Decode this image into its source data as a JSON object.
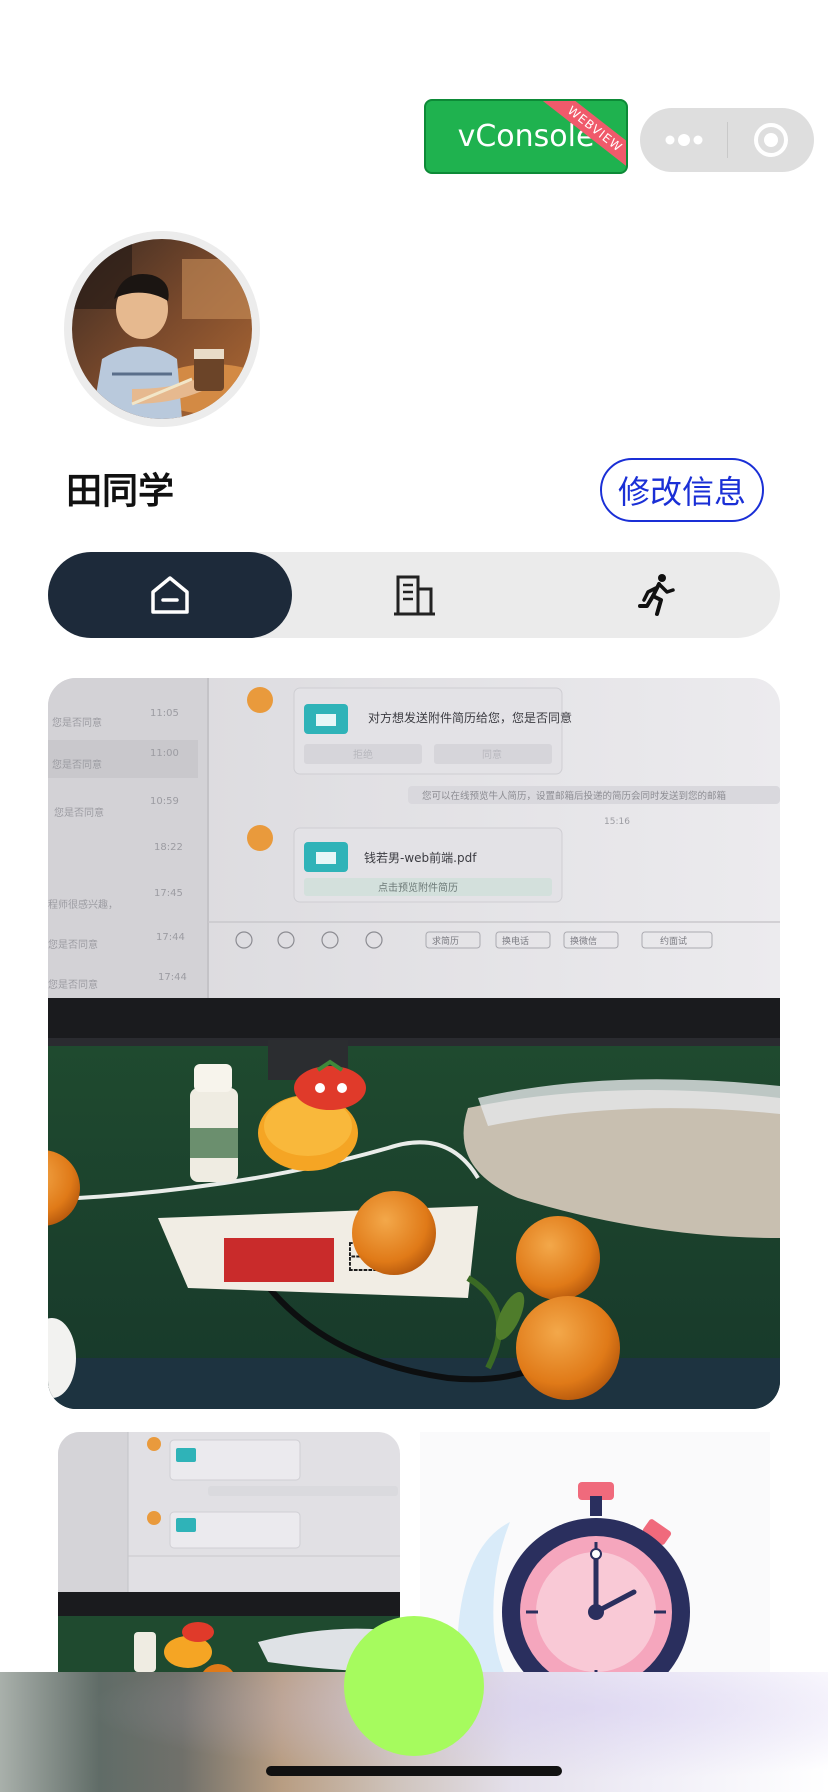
{
  "vconsole": {
    "label": "vConsole",
    "ribbon": "WEBVIEW"
  },
  "capsule": {
    "more_icon": "more-dots-icon",
    "close_icon": "target-circle-icon"
  },
  "profile": {
    "name": "田同学",
    "edit_label": "修改信息",
    "avatar": "avatar-photo"
  },
  "tabs": [
    {
      "icon": "home-icon",
      "active": true
    },
    {
      "icon": "building-icon",
      "active": false
    },
    {
      "icon": "running-person-icon",
      "active": false
    }
  ],
  "feed": {
    "main_photo": {
      "chat": {
        "times": [
          "11:05",
          "11:00",
          "10:59",
          "18:22",
          "17:45",
          "17:44",
          "17:44"
        ],
        "sidebar_snippets": [
          "您是否同意",
          "您是否同意",
          "您是否同意",
          "程师很感兴趣，",
          "您是否同意",
          "您是否同意"
        ],
        "message1": "对方想发送附件简历给您，您是否同意",
        "btn_reject": "拒绝",
        "btn_agree": "同意",
        "system_notice": "您可以在线预览牛人简历，设置邮箱后投递的简历会同时发送到您的邮箱",
        "time_mid": "15:16",
        "file_name": "钱若男-web前端.pdf",
        "file_action": "点击预览附件简历",
        "toolbar": [
          "求简历",
          "换电话",
          "换微信",
          "约面试"
        ]
      }
    }
  },
  "colors": {
    "vconsole_green": "#1fb24f",
    "tab_active": "#1d2a3a",
    "edit_blue": "#1a2fd6",
    "fab_green": "#a6fb5e"
  }
}
